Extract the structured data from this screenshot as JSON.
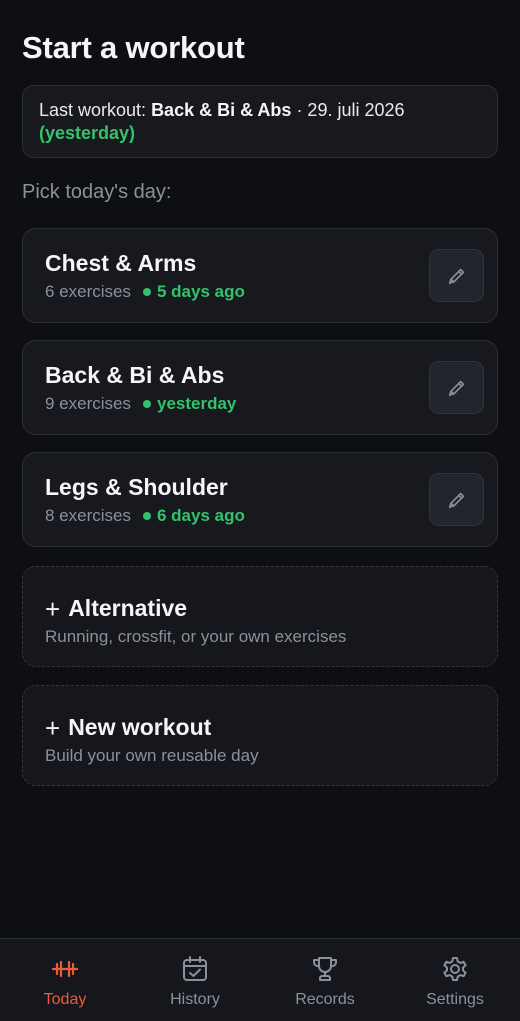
{
  "header": {
    "title": "Start a workout"
  },
  "last_workout": {
    "prefix": "Last workout: ",
    "name": "Back & Bi & Abs",
    "date": " · 29. juli 2026",
    "relative": "(yesterday)"
  },
  "pick_label": "Pick today's day:",
  "days": [
    {
      "name": "Chest & Arms",
      "exercises": "6 exercises",
      "ago": "5 days ago"
    },
    {
      "name": "Back & Bi & Abs",
      "exercises": "9 exercises",
      "ago": "yesterday"
    },
    {
      "name": "Legs & Shoulder",
      "exercises": "8 exercises",
      "ago": "6 days ago"
    }
  ],
  "alternative": {
    "plus": "+",
    "title": "Alternative",
    "subtitle": "Running, crossfit, or your own exercises"
  },
  "new_workout": {
    "plus": "+",
    "title": "New workout",
    "subtitle": "Build your own reusable day"
  },
  "nav": [
    {
      "label": "Today",
      "icon": "dumbbell-icon",
      "active": true
    },
    {
      "label": "History",
      "icon": "calendar-check-icon",
      "active": false
    },
    {
      "label": "Records",
      "icon": "trophy-icon",
      "active": false
    },
    {
      "label": "Settings",
      "icon": "gear-icon",
      "active": false
    }
  ],
  "colors": {
    "accent": "#ef5a3a",
    "green": "#34c26a",
    "background": "#0e0f13",
    "card": "#17191f"
  }
}
